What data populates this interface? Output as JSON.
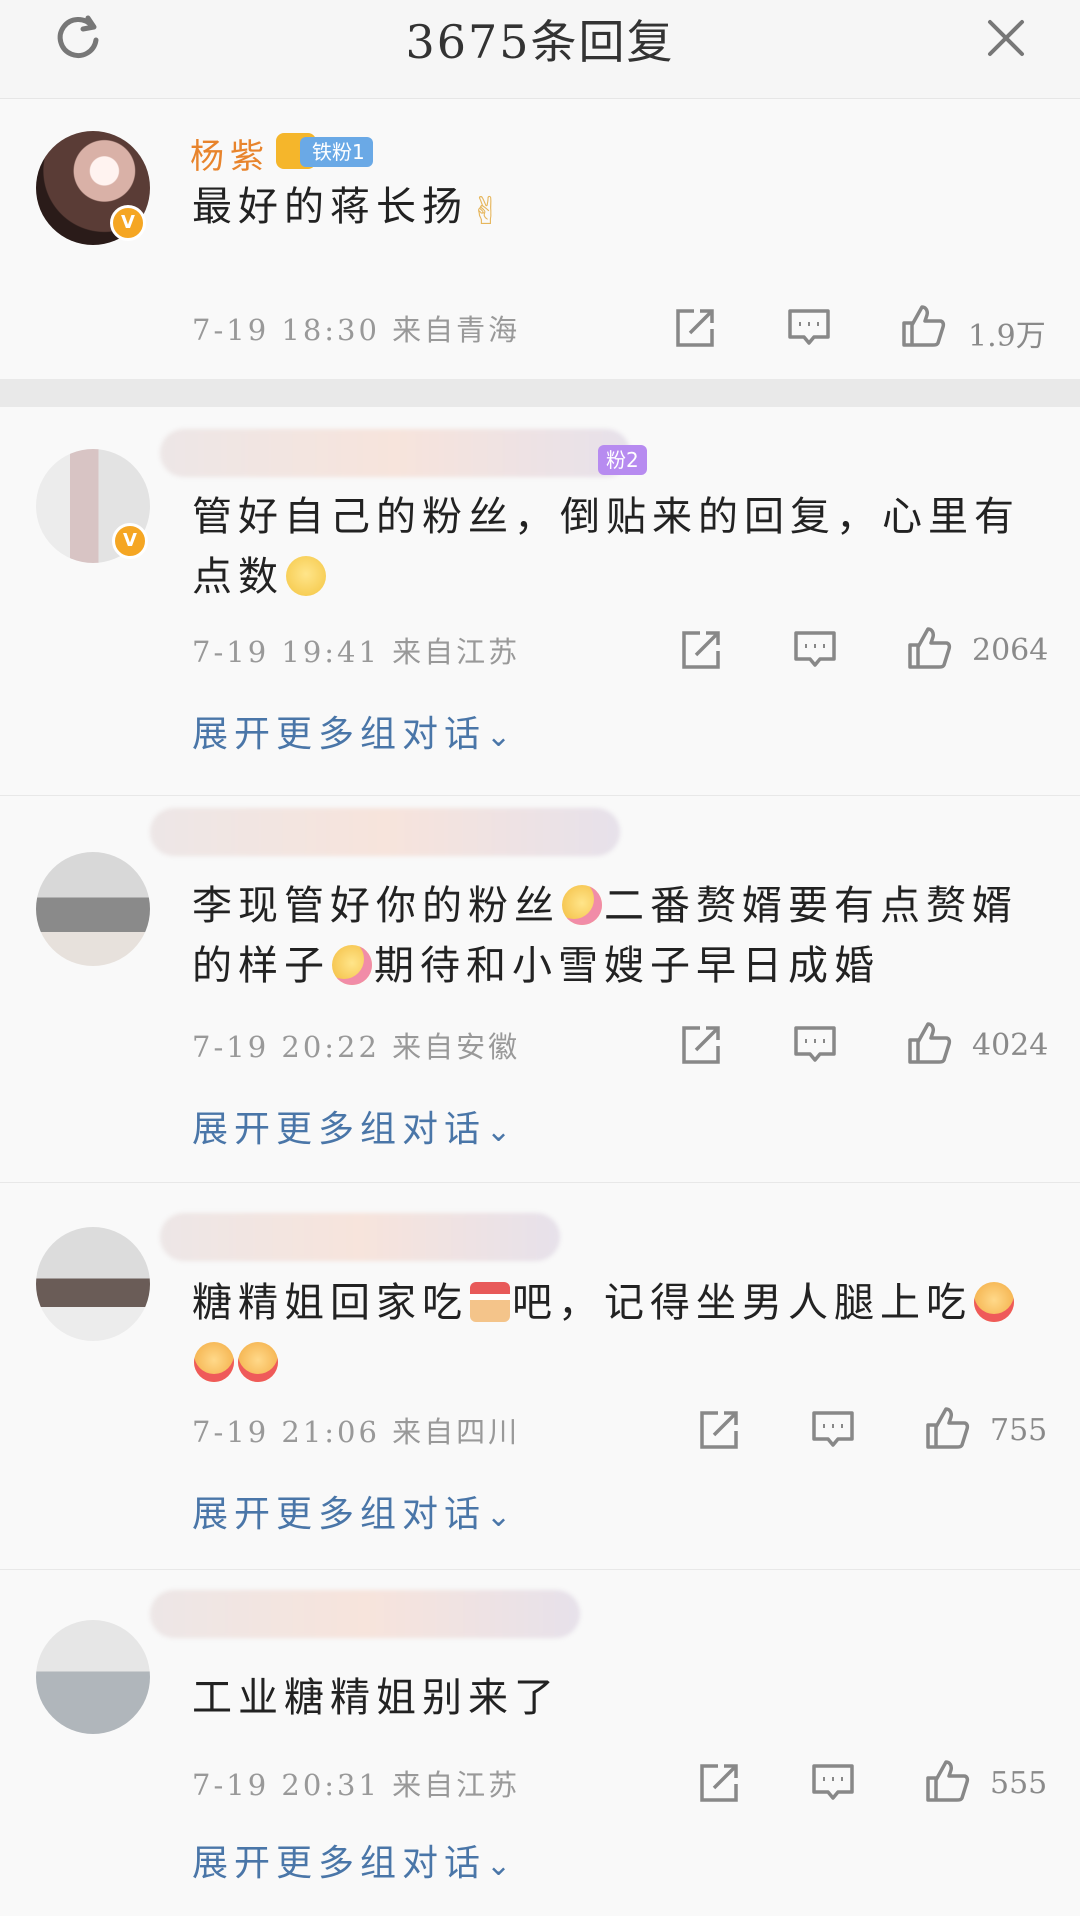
{
  "header": {
    "title": "3675条回复"
  },
  "comments": [
    {
      "username": "杨紫",
      "badge": "铁粉1",
      "text": "最好的蒋长扬",
      "emoji": [
        "victory-emoji"
      ],
      "date": "7-19 18:30",
      "location": "来自青海",
      "likes": "1.9万"
    },
    {
      "badge": "粉2",
      "text_line1": "管好自己的粉丝，倒贴来的回复，心里有",
      "text_line2": "点数",
      "emoji": [
        "smile-emoji"
      ],
      "date": "7-19 19:41",
      "location": "来自江苏",
      "likes": "2064",
      "expand": "展开更多组对话"
    },
    {
      "text_line1a": "李现管好你的粉丝",
      "text_line1b": "二番赘婿要有点赘婿",
      "text_line2a": "的样子",
      "text_line2b": "期待和小雪嫂子早日成婚",
      "emoji": [
        "flower-emoji",
        "flower-emoji"
      ],
      "date": "7-19 20:22",
      "location": "来自安徽",
      "likes": "4024",
      "expand": "展开更多组对话"
    },
    {
      "text_a": "糖精姐回家吃",
      "text_b": "吧，记得坐男人腿上吃",
      "emoji": [
        "cake-emoji",
        "kiss-emoji",
        "kiss-emoji",
        "kiss-emoji"
      ],
      "date": "7-19 21:06",
      "location": "来自四川",
      "likes": "755",
      "expand": "展开更多组对话"
    },
    {
      "text": "工业糖精姐别来了",
      "date": "7-19 20:31",
      "location": "来自江苏",
      "likes": "555",
      "expand": "展开更多组对话"
    }
  ],
  "colors": {
    "username": "#e8842c",
    "link": "#4a76a8",
    "meta": "#999999"
  }
}
